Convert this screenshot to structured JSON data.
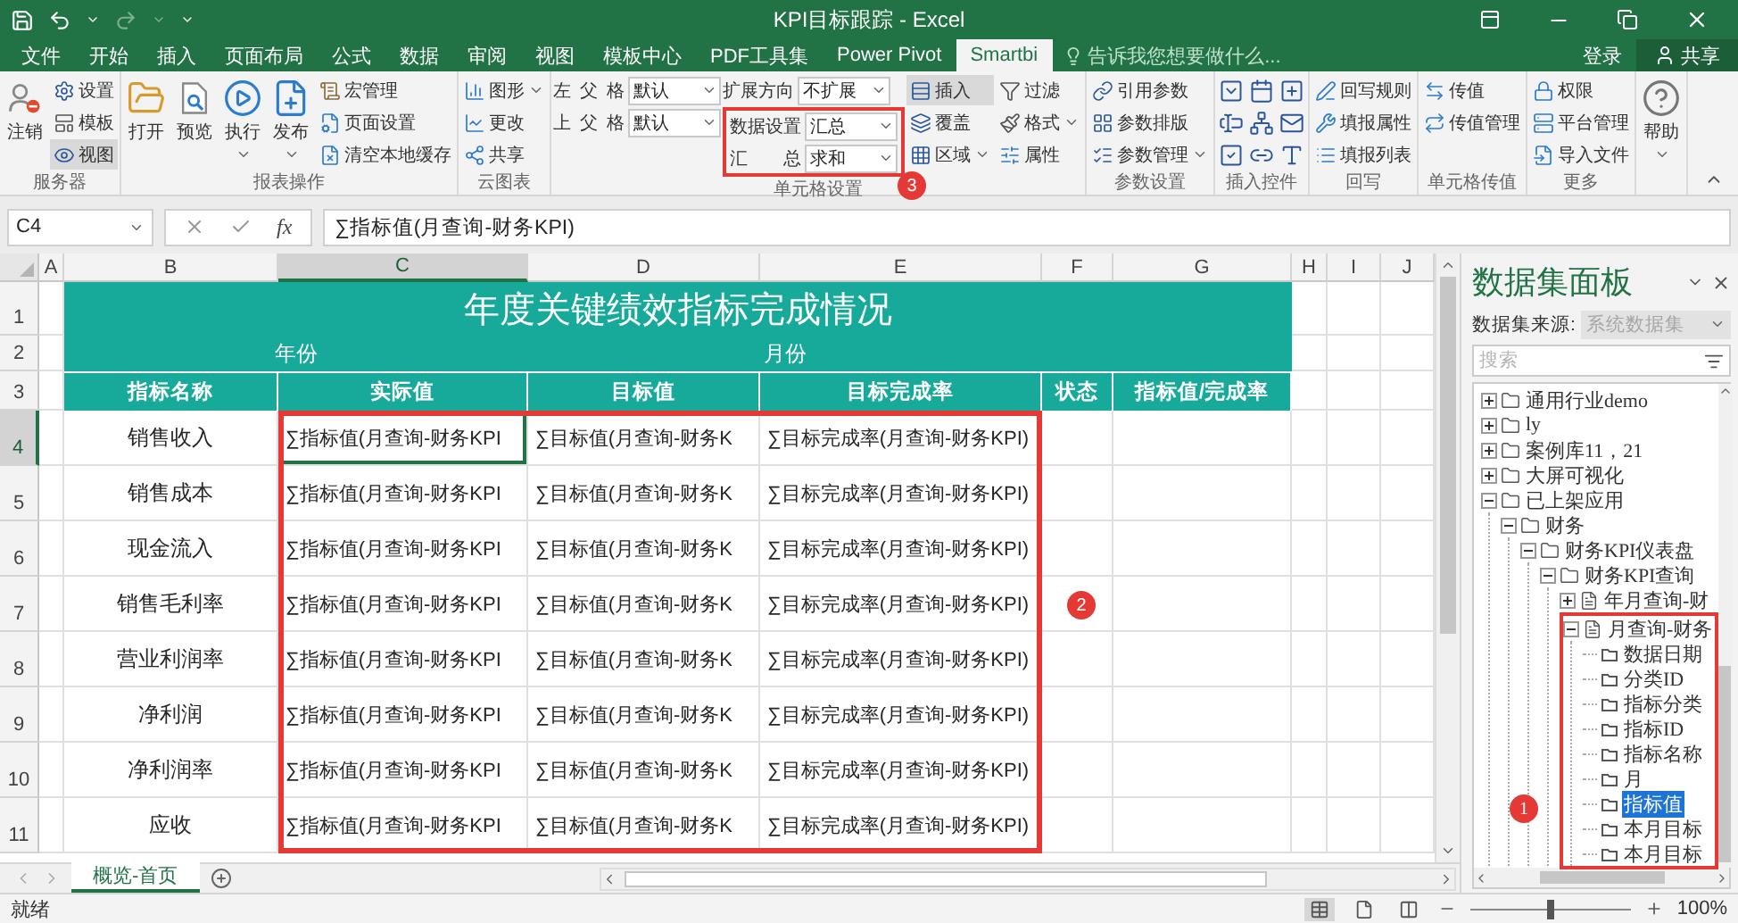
{
  "titlebar": {
    "title": "KPI目标跟踪 - Excel"
  },
  "menu_tabs": [
    {
      "label": "文件",
      "selected": false
    },
    {
      "label": "开始",
      "selected": false
    },
    {
      "label": "插入",
      "selected": false
    },
    {
      "label": "页面布局",
      "selected": false
    },
    {
      "label": "公式",
      "selected": false
    },
    {
      "label": "数据",
      "selected": false
    },
    {
      "label": "审阅",
      "selected": false
    },
    {
      "label": "视图",
      "selected": false
    },
    {
      "label": "模板中心",
      "selected": false
    },
    {
      "label": "PDF工具集",
      "selected": false
    },
    {
      "label": "Power Pivot",
      "selected": false
    },
    {
      "label": "Smartbi",
      "selected": true
    }
  ],
  "tell_me": {
    "placeholder": "告诉我您想要做什么..."
  },
  "account": {
    "sign_in": "登录",
    "share": "共享"
  },
  "ribbon": {
    "groups": [
      {
        "label": "服务器",
        "columns": [
          {
            "items": [
              {
                "kind": "large",
                "label": "注销",
                "pressed": false,
                "dropdown": false
              }
            ]
          },
          {
            "items": [
              {
                "kind": "small",
                "label": "设置",
                "pressed": false,
                "dropdown": false
              },
              {
                "kind": "small",
                "label": "模板",
                "pressed": false,
                "dropdown": false
              },
              {
                "kind": "small",
                "label": "视图",
                "pressed": true,
                "dropdown": false
              }
            ]
          }
        ]
      },
      {
        "label": "报表操作",
        "columns": [
          {
            "items": [
              {
                "kind": "large",
                "label": "打开",
                "pressed": false,
                "dropdown": false
              }
            ]
          },
          {
            "items": [
              {
                "kind": "large",
                "label": "预览",
                "pressed": false,
                "dropdown": false
              }
            ]
          },
          {
            "items": [
              {
                "kind": "large",
                "label": "执行",
                "pressed": false,
                "dropdown": true
              }
            ]
          },
          {
            "items": [
              {
                "kind": "large",
                "label": "发布",
                "pressed": false,
                "dropdown": true
              }
            ]
          },
          {
            "items": [
              {
                "kind": "small",
                "label": "宏管理",
                "pressed": false,
                "dropdown": false
              },
              {
                "kind": "small",
                "label": "页面设置",
                "pressed": false,
                "dropdown": false
              },
              {
                "kind": "small",
                "label": "清空本地缓存",
                "pressed": false,
                "dropdown": false
              }
            ]
          }
        ]
      },
      {
        "label": "云图表",
        "columns": [
          {
            "items": [
              {
                "kind": "small",
                "label": "图形",
                "pressed": false,
                "dropdown": true
              },
              {
                "kind": "small",
                "label": "更改",
                "pressed": false,
                "dropdown": false
              },
              {
                "kind": "small",
                "label": "共享",
                "pressed": false,
                "dropdown": false
              }
            ]
          }
        ]
      },
      {
        "label": "单元格设置",
        "columns": [
          {
            "items": [
              {
                "kind": "field",
                "label": "左父格",
                "value": "默认"
              },
              {
                "kind": "field",
                "label": "上父格",
                "value": "默认"
              }
            ]
          },
          {
            "items": [
              {
                "kind": "field",
                "label": "扩展方向",
                "value": "不扩展"
              },
              {
                "kind": "callout",
                "number": "3",
                "items": [
                  {
                    "kind": "field",
                    "label": "数据设置",
                    "value": "汇总"
                  },
                  {
                    "kind": "field",
                    "label": "汇 总",
                    "value": "求和"
                  }
                ]
              }
            ]
          },
          {
            "items": [
              {
                "kind": "small",
                "label": "插入",
                "pressed": true,
                "dropdown": false
              },
              {
                "kind": "small",
                "label": "覆盖",
                "pressed": false,
                "dropdown": false
              },
              {
                "kind": "small",
                "label": "区域",
                "pressed": false,
                "dropdown": true
              }
            ]
          },
          {
            "items": [
              {
                "kind": "small",
                "label": "过滤",
                "pressed": false,
                "dropdown": false
              },
              {
                "kind": "small",
                "label": "格式",
                "pressed": false,
                "dropdown": true
              },
              {
                "kind": "small",
                "label": "属性",
                "pressed": false,
                "dropdown": false
              }
            ]
          }
        ]
      },
      {
        "label": "参数设置",
        "columns": [
          {
            "items": [
              {
                "kind": "small",
                "label": "引用参数",
                "pressed": false,
                "dropdown": false
              },
              {
                "kind": "small",
                "label": "参数排版",
                "pressed": false,
                "dropdown": false
              },
              {
                "kind": "small",
                "label": "参数管理",
                "pressed": false,
                "dropdown": true
              }
            ]
          }
        ]
      },
      {
        "label": "插入控件",
        "columns": [
          {
            "items": [
              {
                "kind": "icon"
              },
              {
                "kind": "icon"
              },
              {
                "kind": "icon"
              }
            ]
          },
          {
            "items": [
              {
                "kind": "icon"
              },
              {
                "kind": "icon"
              },
              {
                "kind": "icon"
              }
            ]
          },
          {
            "items": [
              {
                "kind": "icon"
              },
              {
                "kind": "icon"
              },
              {
                "kind": "icon"
              }
            ]
          }
        ]
      },
      {
        "label": "回写",
        "columns": [
          {
            "items": [
              {
                "kind": "small",
                "label": "回写规则",
                "pressed": false,
                "dropdown": false
              },
              {
                "kind": "small",
                "label": "填报属性",
                "pressed": false,
                "dropdown": false
              },
              {
                "kind": "small",
                "label": "填报列表",
                "pressed": false,
                "dropdown": false
              }
            ]
          }
        ]
      },
      {
        "label": "单元格传值",
        "columns": [
          {
            "items": [
              {
                "kind": "small",
                "label": "传值",
                "pressed": false,
                "dropdown": false
              },
              {
                "kind": "small",
                "label": "传值管理",
                "pressed": false,
                "dropdown": false
              }
            ]
          }
        ]
      },
      {
        "label": "更多",
        "columns": [
          {
            "items": [
              {
                "kind": "small",
                "label": "权限",
                "pressed": false,
                "dropdown": false
              },
              {
                "kind": "small",
                "label": "平台管理",
                "pressed": false,
                "dropdown": false
              },
              {
                "kind": "small",
                "label": "导入文件",
                "pressed": false,
                "dropdown": false
              }
            ]
          }
        ]
      },
      {
        "columns": [
          {
            "items": [
              {
                "kind": "large",
                "label": "帮助",
                "pressed": false,
                "dropdown": true
              }
            ]
          }
        ]
      }
    ]
  },
  "formula_bar": {
    "name_box": "C4",
    "fx": "fx",
    "formula": "∑指标值(月查询-财务KPI)"
  },
  "sheet": {
    "columns": [
      {
        "label": "A",
        "selected": false
      },
      {
        "label": "B",
        "selected": false
      },
      {
        "label": "C",
        "selected": true
      },
      {
        "label": "D",
        "selected": false
      },
      {
        "label": "E",
        "selected": false
      },
      {
        "label": "F",
        "selected": false
      },
      {
        "label": "G",
        "selected": false
      },
      {
        "label": "H",
        "selected": false
      },
      {
        "label": "I",
        "selected": false
      },
      {
        "label": "J",
        "selected": false
      }
    ],
    "rows": [
      {
        "label": "1",
        "selected": false
      },
      {
        "label": "2",
        "selected": false
      },
      {
        "label": "3",
        "selected": false
      },
      {
        "label": "4",
        "selected": true
      },
      {
        "label": "5",
        "selected": false
      },
      {
        "label": "6",
        "selected": false
      },
      {
        "label": "7",
        "selected": false
      },
      {
        "label": "8",
        "selected": false
      },
      {
        "label": "9",
        "selected": false
      },
      {
        "label": "10",
        "selected": false
      },
      {
        "label": "11",
        "selected": false
      }
    ],
    "title": "年度关键绩效指标完成情况",
    "year_label": "年份",
    "month_label": "月份",
    "headers": [
      "指标名称",
      "实际值",
      "目标值",
      "目标完成率",
      "状态",
      "指标值/完成率"
    ],
    "data": [
      {
        "name": "销售收入",
        "values": [
          "∑指标值(月查询-财务KPI",
          "∑目标值(月查询-财务K",
          "∑目标完成率(月查询-财务KPI)"
        ]
      },
      {
        "name": "销售成本",
        "values": [
          "∑指标值(月查询-财务KPI",
          "∑目标值(月查询-财务K",
          "∑目标完成率(月查询-财务KPI)"
        ]
      },
      {
        "name": "现金流入",
        "values": [
          "∑指标值(月查询-财务KPI",
          "∑目标值(月查询-财务K",
          "∑目标完成率(月查询-财务KPI)"
        ]
      },
      {
        "name": "销售毛利率",
        "values": [
          "∑指标值(月查询-财务KPI",
          "∑目标值(月查询-财务K",
          "∑目标完成率(月查询-财务KPI)"
        ]
      },
      {
        "name": "营业利润率",
        "values": [
          "∑指标值(月查询-财务KPI",
          "∑目标值(月查询-财务K",
          "∑目标完成率(月查询-财务KPI)"
        ]
      },
      {
        "name": "净利润",
        "values": [
          "∑指标值(月查询-财务KPI",
          "∑目标值(月查询-财务K",
          "∑目标完成率(月查询-财务KPI)"
        ]
      },
      {
        "name": "净利润率",
        "values": [
          "∑指标值(月查询-财务KPI",
          "∑目标值(月查询-财务K",
          "∑目标完成率(月查询-财务KPI)"
        ]
      },
      {
        "name": "应收",
        "values": [
          "∑指标值(月查询-财务KPI",
          "∑目标值(月查询-财务K",
          "∑目标完成率(月查询-财务KPI)"
        ]
      }
    ],
    "callout": "2"
  },
  "panel": {
    "title": "数据集面板",
    "source_label": "数据集来源:",
    "source_value": "系统数据集",
    "search_placeholder": "搜索",
    "tree": [
      {
        "label": "通用行业demo",
        "kind": "folder",
        "expanded": false
      },
      {
        "label": "ly",
        "kind": "folder",
        "expanded": false
      },
      {
        "label": "案例库11，21",
        "kind": "folder",
        "expanded": false
      },
      {
        "label": "大屏可视化",
        "kind": "folder",
        "expanded": false
      },
      {
        "label": "已上架应用",
        "kind": "folder",
        "expanded": true,
        "children": [
          {
            "label": "财务",
            "kind": "folder",
            "expanded": true,
            "children": [
              {
                "label": "财务KPI仪表盘",
                "kind": "folder",
                "expanded": true,
                "children": [
                  {
                    "label": "财务KPI查询",
                    "kind": "folder",
                    "expanded": true,
                    "children": [
                      {
                        "label": "年月查询-财",
                        "kind": "query",
                        "expanded": false
                      },
                      {
                        "label": "月查询-财务",
                        "kind": "query",
                        "expanded": true,
                        "callout": "1",
                        "children": [
                          {
                            "label": "数据日期",
                            "kind": "field",
                            "selected": false
                          },
                          {
                            "label": "分类ID",
                            "kind": "field",
                            "selected": false
                          },
                          {
                            "label": "指标分类",
                            "kind": "field",
                            "selected": false
                          },
                          {
                            "label": "指标ID",
                            "kind": "field",
                            "selected": false
                          },
                          {
                            "label": "指标名称",
                            "kind": "field",
                            "selected": false
                          },
                          {
                            "label": "月",
                            "kind": "field",
                            "selected": false
                          },
                          {
                            "label": "指标值",
                            "kind": "field",
                            "selected": true
                          },
                          {
                            "label": "本月目标",
                            "kind": "field",
                            "selected": false
                          },
                          {
                            "label": "本月目标",
                            "kind": "field",
                            "selected": false
                          }
                        ]
                      }
                    ]
                  }
                ]
              }
            ]
          }
        ]
      }
    ]
  },
  "sheet_tabs": [
    {
      "label": "概览-首页",
      "selected": true
    }
  ],
  "status_bar": {
    "status": "就绪",
    "views": [
      {
        "selected": true
      },
      {
        "selected": false
      },
      {
        "selected": false
      }
    ],
    "zoom": {
      "level": 0.5,
      "reading": "100%"
    }
  }
}
